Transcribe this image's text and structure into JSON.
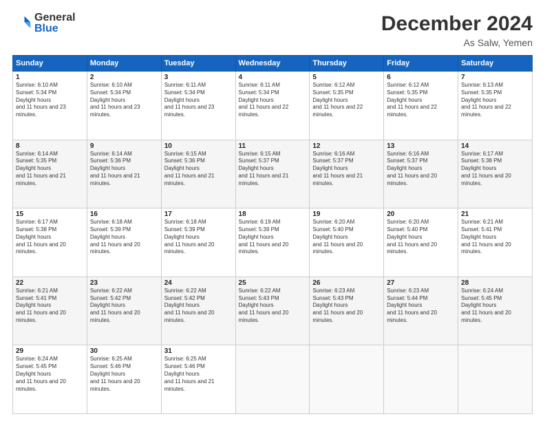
{
  "logo": {
    "general": "General",
    "blue": "Blue"
  },
  "title": {
    "month_year": "December 2024",
    "location": "As Salw, Yemen"
  },
  "weekdays": [
    "Sunday",
    "Monday",
    "Tuesday",
    "Wednesday",
    "Thursday",
    "Friday",
    "Saturday"
  ],
  "weeks": [
    [
      {
        "day": "1",
        "rise": "6:10 AM",
        "set": "5:34 PM",
        "daylight": "11 hours and 23 minutes."
      },
      {
        "day": "2",
        "rise": "6:10 AM",
        "set": "5:34 PM",
        "daylight": "11 hours and 23 minutes."
      },
      {
        "day": "3",
        "rise": "6:11 AM",
        "set": "5:34 PM",
        "daylight": "11 hours and 23 minutes."
      },
      {
        "day": "4",
        "rise": "6:11 AM",
        "set": "5:34 PM",
        "daylight": "11 hours and 22 minutes."
      },
      {
        "day": "5",
        "rise": "6:12 AM",
        "set": "5:35 PM",
        "daylight": "11 hours and 22 minutes."
      },
      {
        "day": "6",
        "rise": "6:12 AM",
        "set": "5:35 PM",
        "daylight": "11 hours and 22 minutes."
      },
      {
        "day": "7",
        "rise": "6:13 AM",
        "set": "5:35 PM",
        "daylight": "11 hours and 22 minutes."
      }
    ],
    [
      {
        "day": "8",
        "rise": "6:14 AM",
        "set": "5:35 PM",
        "daylight": "11 hours and 21 minutes."
      },
      {
        "day": "9",
        "rise": "6:14 AM",
        "set": "5:36 PM",
        "daylight": "11 hours and 21 minutes."
      },
      {
        "day": "10",
        "rise": "6:15 AM",
        "set": "5:36 PM",
        "daylight": "11 hours and 21 minutes."
      },
      {
        "day": "11",
        "rise": "6:15 AM",
        "set": "5:37 PM",
        "daylight": "11 hours and 21 minutes."
      },
      {
        "day": "12",
        "rise": "6:16 AM",
        "set": "5:37 PM",
        "daylight": "11 hours and 21 minutes."
      },
      {
        "day": "13",
        "rise": "6:16 AM",
        "set": "5:37 PM",
        "daylight": "11 hours and 20 minutes."
      },
      {
        "day": "14",
        "rise": "6:17 AM",
        "set": "5:38 PM",
        "daylight": "11 hours and 20 minutes."
      }
    ],
    [
      {
        "day": "15",
        "rise": "6:17 AM",
        "set": "5:38 PM",
        "daylight": "11 hours and 20 minutes."
      },
      {
        "day": "16",
        "rise": "6:18 AM",
        "set": "5:39 PM",
        "daylight": "11 hours and 20 minutes."
      },
      {
        "day": "17",
        "rise": "6:18 AM",
        "set": "5:39 PM",
        "daylight": "11 hours and 20 minutes."
      },
      {
        "day": "18",
        "rise": "6:19 AM",
        "set": "5:39 PM",
        "daylight": "11 hours and 20 minutes."
      },
      {
        "day": "19",
        "rise": "6:20 AM",
        "set": "5:40 PM",
        "daylight": "11 hours and 20 minutes."
      },
      {
        "day": "20",
        "rise": "6:20 AM",
        "set": "5:40 PM",
        "daylight": "11 hours and 20 minutes."
      },
      {
        "day": "21",
        "rise": "6:21 AM",
        "set": "5:41 PM",
        "daylight": "11 hours and 20 minutes."
      }
    ],
    [
      {
        "day": "22",
        "rise": "6:21 AM",
        "set": "5:41 PM",
        "daylight": "11 hours and 20 minutes."
      },
      {
        "day": "23",
        "rise": "6:22 AM",
        "set": "5:42 PM",
        "daylight": "11 hours and 20 minutes."
      },
      {
        "day": "24",
        "rise": "6:22 AM",
        "set": "5:42 PM",
        "daylight": "11 hours and 20 minutes."
      },
      {
        "day": "25",
        "rise": "6:22 AM",
        "set": "5:43 PM",
        "daylight": "11 hours and 20 minutes."
      },
      {
        "day": "26",
        "rise": "6:23 AM",
        "set": "5:43 PM",
        "daylight": "11 hours and 20 minutes."
      },
      {
        "day": "27",
        "rise": "6:23 AM",
        "set": "5:44 PM",
        "daylight": "11 hours and 20 minutes."
      },
      {
        "day": "28",
        "rise": "6:24 AM",
        "set": "5:45 PM",
        "daylight": "11 hours and 20 minutes."
      }
    ],
    [
      {
        "day": "29",
        "rise": "6:24 AM",
        "set": "5:45 PM",
        "daylight": "11 hours and 20 minutes."
      },
      {
        "day": "30",
        "rise": "6:25 AM",
        "set": "5:46 PM",
        "daylight": "11 hours and 20 minutes."
      },
      {
        "day": "31",
        "rise": "6:25 AM",
        "set": "5:46 PM",
        "daylight": "11 hours and 21 minutes."
      },
      null,
      null,
      null,
      null
    ]
  ]
}
